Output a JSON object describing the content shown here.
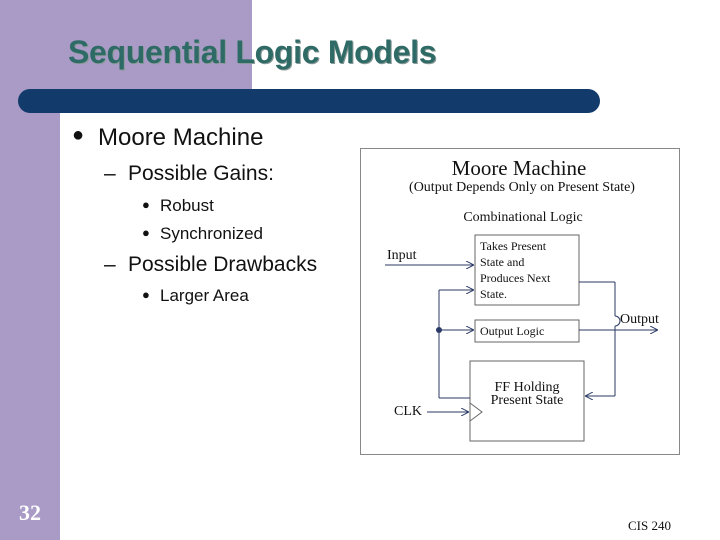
{
  "slide": {
    "title": "Sequential Logic Models",
    "number": "32",
    "footer": "CIS 240"
  },
  "bullets": {
    "main": "Moore Machine",
    "gains_heading": "Possible Gains:",
    "gains": [
      "Robust",
      "Synchronized"
    ],
    "drawbacks_heading": "Possible Drawbacks",
    "drawbacks": [
      "Larger Area"
    ]
  },
  "diagram": {
    "title": "Moore Machine",
    "subtitle": "(Output Depends Only on Present State)",
    "combinational_label": "Combinational Logic",
    "next_state_box": [
      "Takes Present",
      "State and",
      "Produces Next",
      "State."
    ],
    "output_logic": "Output Logic",
    "ff_box": [
      "FF Holding",
      "Present State"
    ],
    "input_label": "Input",
    "output_label": "Output",
    "clk_label": "CLK"
  },
  "colors": {
    "purple_band": "#a99bc6",
    "title_color": "#2f6b66",
    "title_bar": "#123a6b"
  }
}
